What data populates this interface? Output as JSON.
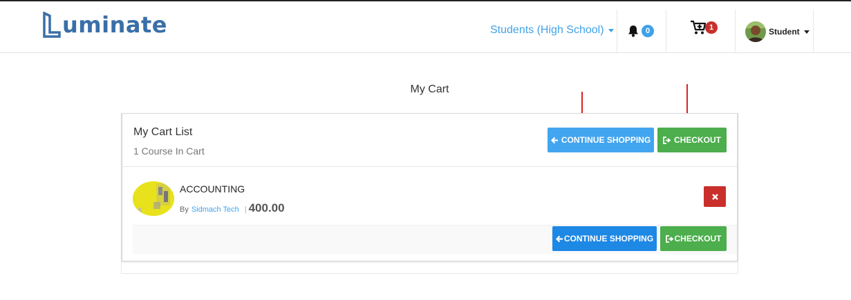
{
  "brand": {
    "name": "uminate",
    "color": "#3a6fa8"
  },
  "header": {
    "role_label": "Students (High School)",
    "notifications_count": "0",
    "cart_count": "1",
    "user_name": "Student"
  },
  "page": {
    "title": "My Cart"
  },
  "cart": {
    "list_title": "My Cart List",
    "count_text": "1 Course In Cart",
    "continue_label": "CONTINUE SHOPPING",
    "checkout_label": "CHECKOUT",
    "items": [
      {
        "name": "ACCOUNTING",
        "by_label": "By",
        "author": "Sidmach Tech",
        "price": "400.00"
      }
    ]
  },
  "colors": {
    "accent_blue": "#3fa2e8",
    "button_blue": "#1e88e5",
    "button_green": "#4cae4c",
    "button_red": "#c9302c",
    "annotation_red": "#e02020"
  },
  "icons": [
    "bell-icon",
    "cart-plus-icon",
    "caret-down-icon",
    "arrow-left-icon",
    "sign-out-icon",
    "times-icon"
  ]
}
